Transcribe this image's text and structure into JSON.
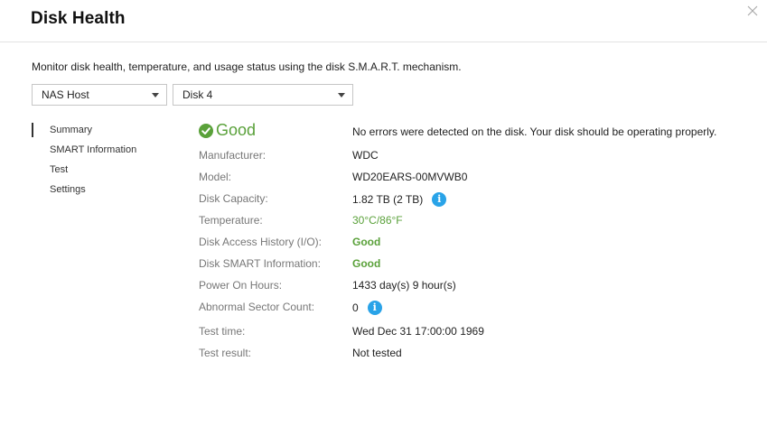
{
  "window": {
    "title": "Disk Health"
  },
  "description": "Monitor disk health, temperature, and usage status using the disk S.M.A.R.T. mechanism.",
  "selectors": {
    "host": "NAS Host",
    "disk": "Disk 4"
  },
  "nav": {
    "items": [
      {
        "label": "Summary",
        "active": true
      },
      {
        "label": "SMART Information",
        "active": false
      },
      {
        "label": "Test",
        "active": false
      },
      {
        "label": "Settings",
        "active": false
      }
    ]
  },
  "summary": {
    "status": "Good",
    "status_message": "No errors were detected on the disk. Your disk should be operating properly.",
    "status_color": "#5aa13a",
    "fields": [
      {
        "label": "Manufacturer:",
        "value": "WDC"
      },
      {
        "label": "Model:",
        "value": "WD20EARS-00MVWB0"
      },
      {
        "label": "Disk Capacity:",
        "value": "1.82 TB (2 TB)",
        "info": "i"
      },
      {
        "label": "Temperature:",
        "value": "30°C/86°F"
      },
      {
        "label": "Disk Access History (I/O):",
        "value": "Good"
      },
      {
        "label": "Disk SMART Information:",
        "value": "Good"
      },
      {
        "label": "Power On Hours:",
        "value": "1433 day(s) 9 hour(s)"
      },
      {
        "label": "Abnormal Sector Count:",
        "value": "0",
        "info": "i"
      },
      {
        "label": "Test time:",
        "value": "Wed Dec 31 17:00:00 1969"
      },
      {
        "label": "Test result:",
        "value": "Not tested"
      }
    ]
  },
  "colors": {
    "accent_info": "#29a3e8",
    "good": "#5aa13a"
  }
}
